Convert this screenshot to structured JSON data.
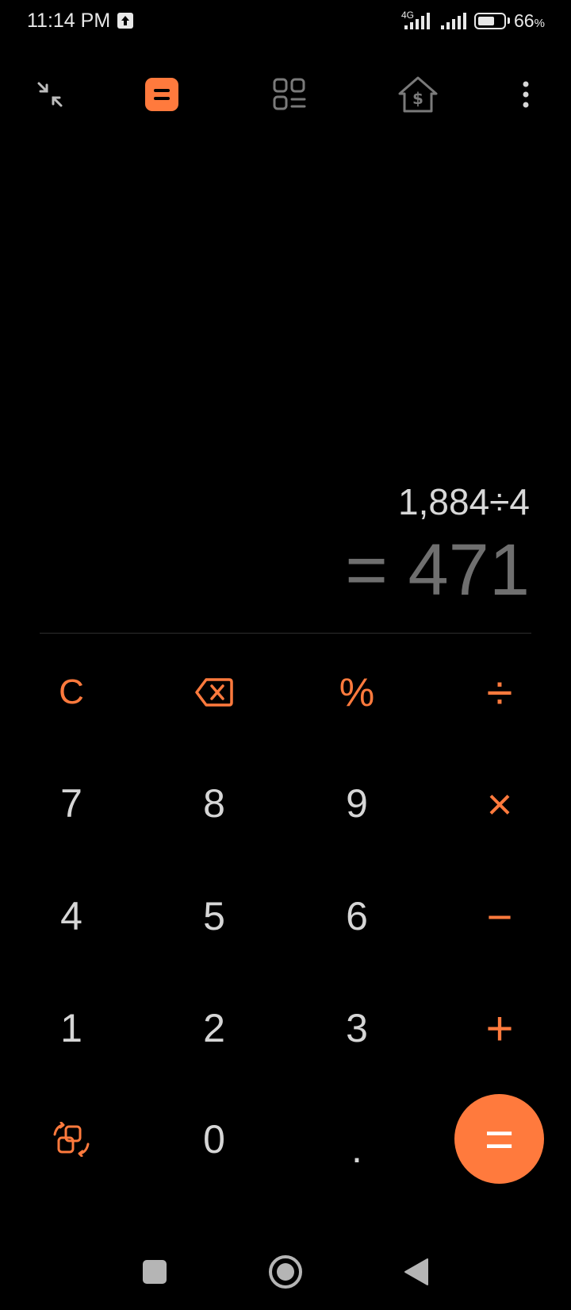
{
  "status_bar": {
    "time": "11:14 PM",
    "network": "4G",
    "battery_level": 0.66,
    "battery_percent": "66",
    "battery_unit": "%"
  },
  "toolbar": {
    "icons": [
      "collapse-icon",
      "calculator-icon",
      "tools-grid-icon",
      "mortgage-icon",
      "more-vert-icon"
    ]
  },
  "display": {
    "expression": "1,884÷4",
    "result": "= 471"
  },
  "keypad": {
    "clear": "C",
    "percent": "%",
    "divide": "÷",
    "multiply": "×",
    "minus": "−",
    "plus": "+",
    "equals": "=",
    "dot": ".",
    "digits": {
      "d0": "0",
      "d1": "1",
      "d2": "2",
      "d3": "3",
      "d4": "4",
      "d5": "5",
      "d6": "6",
      "d7": "7",
      "d8": "8",
      "d9": "9"
    }
  },
  "colors": {
    "accent": "#ff7a3d",
    "background": "#000000",
    "digit_text": "#d6d6d6",
    "result_text": "#6f6f6f"
  }
}
